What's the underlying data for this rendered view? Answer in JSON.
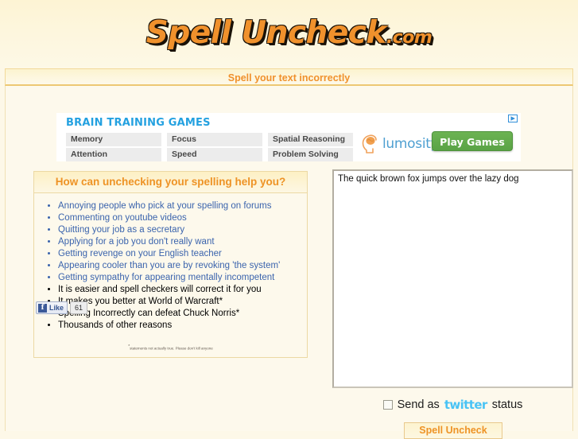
{
  "site": {
    "logo_main": "Spell Uncheck",
    "logo_suffix": ".com",
    "tagline": "Spell your text incorrectly",
    "brand_orange": "#f0912c"
  },
  "ad": {
    "title": "BRAIN TRAINING GAMES",
    "adchoices_icon": "adchoices-triangle-icon",
    "cells": [
      [
        "Memory",
        "Attention"
      ],
      [
        "Focus",
        "Speed"
      ],
      [
        "Spatial Reasoning",
        "Problem Solving"
      ]
    ],
    "brand_name": "lumosity",
    "brand_icon": "lumosity-head-icon",
    "cta_label": "Play Games",
    "cta_color": "#5aa346",
    "title_color": "#24a1e0"
  },
  "info_panel": {
    "heading": "How can unchecking your spelling help you?",
    "items": [
      {
        "text": "Annoying people who pick at your spelling on forums",
        "link": true
      },
      {
        "text": "Commenting on youtube videos",
        "link": true
      },
      {
        "text": "Quitting your job as a secretary",
        "link": true
      },
      {
        "text": "Applying for a job you don't really want",
        "link": true
      },
      {
        "text": "Getting revenge on your English teacher",
        "link": true
      },
      {
        "text": "Appearing cooler than you are by revoking 'the system'",
        "link": true
      },
      {
        "text": "Getting sympathy for appearing mentally incompetent",
        "link": true
      },
      {
        "text": "It is easier and spell checkers will correct it for you",
        "link": false
      },
      {
        "text": "It makes you better at World of Warcraft*",
        "link": false
      },
      {
        "text": "Spelling Incorrectly can defeat Chuck Norris*",
        "link": false
      },
      {
        "text": "Thousands of other reasons",
        "link": false
      }
    ],
    "footnote_marker": "*",
    "footnote": "statements not actually true. Please don't kill anyone"
  },
  "social": {
    "facebook_icon": "facebook-f-icon",
    "like_label": "Like",
    "like_count": "61"
  },
  "editor": {
    "text": "The quick brown fox jumps over the lazy dog",
    "placeholder": ""
  },
  "controls": {
    "twitter_prefix": "Send as",
    "twitter_logo": "twitter",
    "twitter_suffix": "status",
    "twitter_checked": false,
    "submit_label": "Spell Uncheck"
  }
}
